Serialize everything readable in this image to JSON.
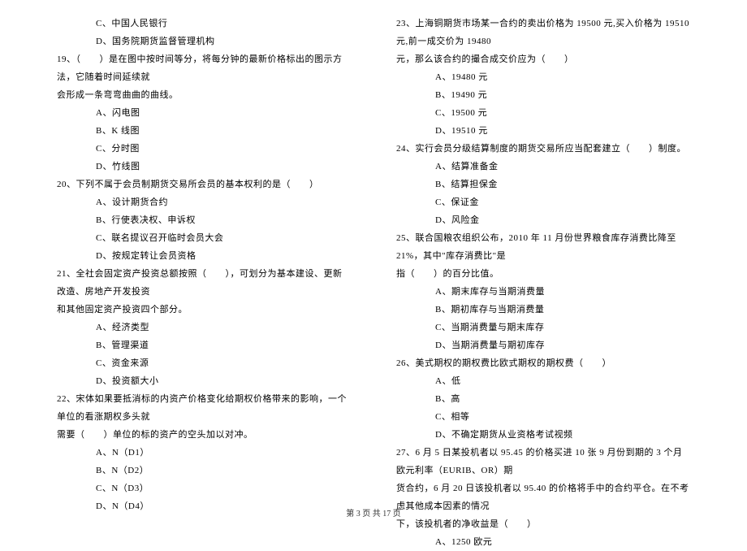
{
  "left_column": {
    "pre_options": [
      "C、中国人民银行",
      "D、国务院期货监督管理机构"
    ],
    "q19": {
      "line1": "19、（　　）是在图中按时间等分，将每分钟的最新价格标出的图示方法，它随着时间延续就",
      "line2": "会形成一条弯弯曲曲的曲线。",
      "options": [
        "A、闪电图",
        "B、K 线图",
        "C、分时图",
        "D、竹线图"
      ]
    },
    "q20": {
      "line1": "20、下列不属于会员制期货交易所会员的基本权利的是（　　）",
      "options": [
        "A、设计期货合约",
        "B、行使表决权、申诉权",
        "C、联名提议召开临时会员大会",
        "D、按规定转让会员资格"
      ]
    },
    "q21": {
      "line1": "21、全社会固定资产投资总额按照（　　），可划分为基本建设、更新改造、房地产开发投资",
      "line2": "和其他固定资产投资四个部分。",
      "options": [
        "A、经济类型",
        "B、管理渠道",
        "C、资金来源",
        "D、投资额大小"
      ]
    },
    "q22": {
      "line1": "22、宋体如果要抵消标的内资产价格变化给期权价格带来的影响，一个单位的看涨期权多头就",
      "line2": "需要（　　）单位的标的资产的空头加以对冲。",
      "options": [
        "A、N（D1）",
        "B、N（D2）",
        "C、N（D3）",
        "D、N（D4）"
      ]
    }
  },
  "right_column": {
    "q23": {
      "line1": "23、上海铜期货市场某一合约的卖出价格为 19500 元,买入价格为 19510 元,前一成交价为 19480",
      "line2": "元，那么该合约的撮合成交价应为（　　）",
      "options": [
        "A、19480 元",
        "B、19490 元",
        "C、19500 元",
        "D、19510 元"
      ]
    },
    "q24": {
      "line1": "24、实行会员分级结算制度的期货交易所应当配套建立（　　）制度。",
      "options": [
        "A、结算准备金",
        "B、结算担保金",
        "C、保证金",
        "D、风险金"
      ]
    },
    "q25": {
      "line1": "25、联合国粮农组织公布，2010 年 11 月份世界粮食库存消费比降至 21%，其中\"库存消费比\"是",
      "line2": "指（　　）的百分比值。",
      "options": [
        "A、期末库存与当期消费量",
        "B、期初库存与当期消费量",
        "C、当期消费量与期末库存",
        "D、当期消费量与期初库存"
      ]
    },
    "q26": {
      "line1": "26、美式期权的期权费比欧式期权的期权费（　　）",
      "options": [
        "A、低",
        "B、高",
        "C、相等",
        "D、不确定期货从业资格考试视频"
      ]
    },
    "q27": {
      "line1": "27、6 月 5 日某投机者以 95.45 的价格买进 10 张 9 月份到期的 3 个月欧元利率（EURIB、OR）期",
      "line2": "货合约，6 月 20 日该投机者以 95.40 的价格将手中的合约平仓。在不考虑其他成本因素的情况",
      "line3": "下，该投机者的净收益是（　　）",
      "options": [
        "A、1250 欧元"
      ]
    }
  },
  "footer": "第 3 页 共 17 页"
}
